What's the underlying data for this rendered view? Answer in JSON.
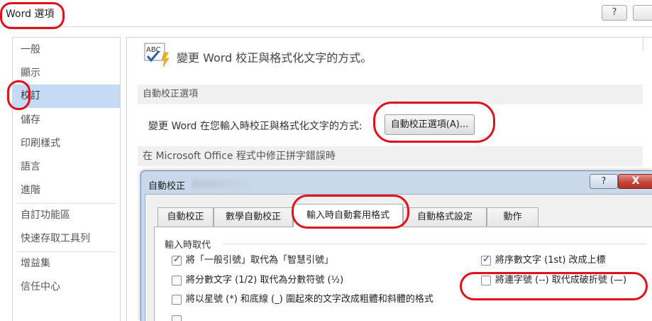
{
  "outer_window": {
    "title": "Word 選項",
    "help_glyph": "?",
    "close_glyph": ""
  },
  "nav": {
    "items": [
      {
        "label": "一般",
        "selected": false
      },
      {
        "label": "顯示",
        "selected": false
      },
      {
        "label": "校訂",
        "selected": true
      },
      {
        "label": "儲存",
        "selected": false
      },
      {
        "label": "印刷樣式",
        "selected": false
      },
      {
        "label": "語言",
        "selected": false
      },
      {
        "label": "進階",
        "selected": false
      },
      {
        "label": "自訂功能區",
        "selected": false
      },
      {
        "label": "快速存取工具列",
        "selected": false
      },
      {
        "label": "增益集",
        "selected": false
      },
      {
        "label": "信任中心",
        "selected": false
      }
    ]
  },
  "content": {
    "icon_text": "ABC",
    "header": "變更 Word 校正與格式化文字的方式。",
    "section1_title": "自動校正選項",
    "autocorrect_description": "變更 Word 在您輸入時校正與格式化文字的方式:",
    "autocorrect_button": "自動校正選項(A)...",
    "section2_title": "在 Microsoft Office 程式中修正拼字錯誤時"
  },
  "dialog": {
    "title": "自動校正",
    "help_glyph": "?",
    "close_glyph": "X",
    "tabs": [
      {
        "label": "自動校正",
        "active": false
      },
      {
        "label": "數學自動校正",
        "active": false
      },
      {
        "label": "輸入時自動套用格式",
        "active": true
      },
      {
        "label": "自動格式設定",
        "active": false
      },
      {
        "label": "動作",
        "active": false
      }
    ],
    "group_label": "輸入時取代",
    "options": [
      {
        "label": "將「一般引號」取代為「智慧引號」",
        "checked": true
      },
      {
        "label": "將序數文字 (1st) 改成上標",
        "checked": true
      },
      {
        "label": "將分數文字 (1/2) 取代為分數符號 (½)",
        "checked": false
      },
      {
        "label": "將連字號 (--) 取代成破折號 (—)",
        "checked": false
      },
      {
        "label": "將以星號 (*) 和底線 (_) 圍起來的文字改成粗體和斜體的格式",
        "checked": false
      }
    ]
  },
  "colors": {
    "selected_nav": "#c5daf5",
    "annotation_red": "#e0101c",
    "dialog_frame": "#c9d9eb",
    "close_red": "#c6463a"
  }
}
